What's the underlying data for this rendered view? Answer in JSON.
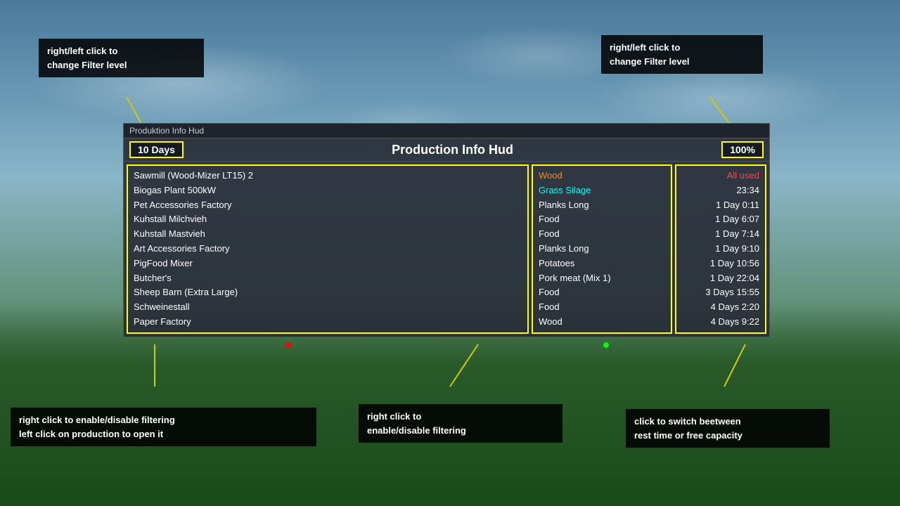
{
  "background": {
    "description": "Sky and trees background from farming simulator"
  },
  "hud": {
    "title_bar": "Produktion Info Hud",
    "main_title": "Production Info Hud",
    "filter_left": "10 Days",
    "filter_right": "100%",
    "productions": [
      "Sawmill (Wood-Mizer LT15) 2",
      "Biogas Plant 500kW",
      "Pet Accessories Factory",
      "Kuhstall Milchvieh",
      "Kuhstall Mastvieh",
      "Art Accessories Factory",
      "PigFood Mixer",
      "Butcher's",
      "Sheep Barn (Extra Large)",
      "Schweinestall",
      "Paper Factory"
    ],
    "outputs": [
      {
        "text": "Wood",
        "color": "orange"
      },
      {
        "text": "Grass Silage",
        "color": "cyan"
      },
      {
        "text": "Planks Long",
        "color": "white"
      },
      {
        "text": "Food",
        "color": "white"
      },
      {
        "text": "Food",
        "color": "white"
      },
      {
        "text": "Planks Long",
        "color": "white"
      },
      {
        "text": "Potatoes",
        "color": "white"
      },
      {
        "text": "Pork meat (Mix 1)",
        "color": "white"
      },
      {
        "text": "Food",
        "color": "white"
      },
      {
        "text": "Food",
        "color": "white"
      },
      {
        "text": "Wood",
        "color": "white"
      }
    ],
    "times": [
      {
        "text": "All used",
        "color": "red"
      },
      {
        "text": "23:34",
        "color": "white"
      },
      {
        "text": "1 Day 0:11",
        "color": "white"
      },
      {
        "text": "1 Day 6:07",
        "color": "white"
      },
      {
        "text": "1 Day 7:14",
        "color": "white"
      },
      {
        "text": "1 Day 9:10",
        "color": "white"
      },
      {
        "text": "1 Day 10:56",
        "color": "white"
      },
      {
        "text": "1 Day 22:04",
        "color": "white"
      },
      {
        "text": "3 Days 15:55",
        "color": "white"
      },
      {
        "text": "4 Days 2:20",
        "color": "white"
      },
      {
        "text": "4 Days 9:22",
        "color": "white"
      }
    ]
  },
  "annotations": {
    "top_left": {
      "line1": "right/left click to",
      "line2": "change Filter level"
    },
    "top_right": {
      "line1": "right/left click to",
      "line2": "change Filter level"
    },
    "bottom_left": {
      "line1": "right click to enable/disable filtering",
      "line2": "left click on production to open it"
    },
    "bottom_center": {
      "line1": "right click to",
      "line2": "enable/disable filtering"
    },
    "bottom_right": {
      "line1": "click to switch beetween",
      "line2": "rest time or free capacity"
    }
  }
}
